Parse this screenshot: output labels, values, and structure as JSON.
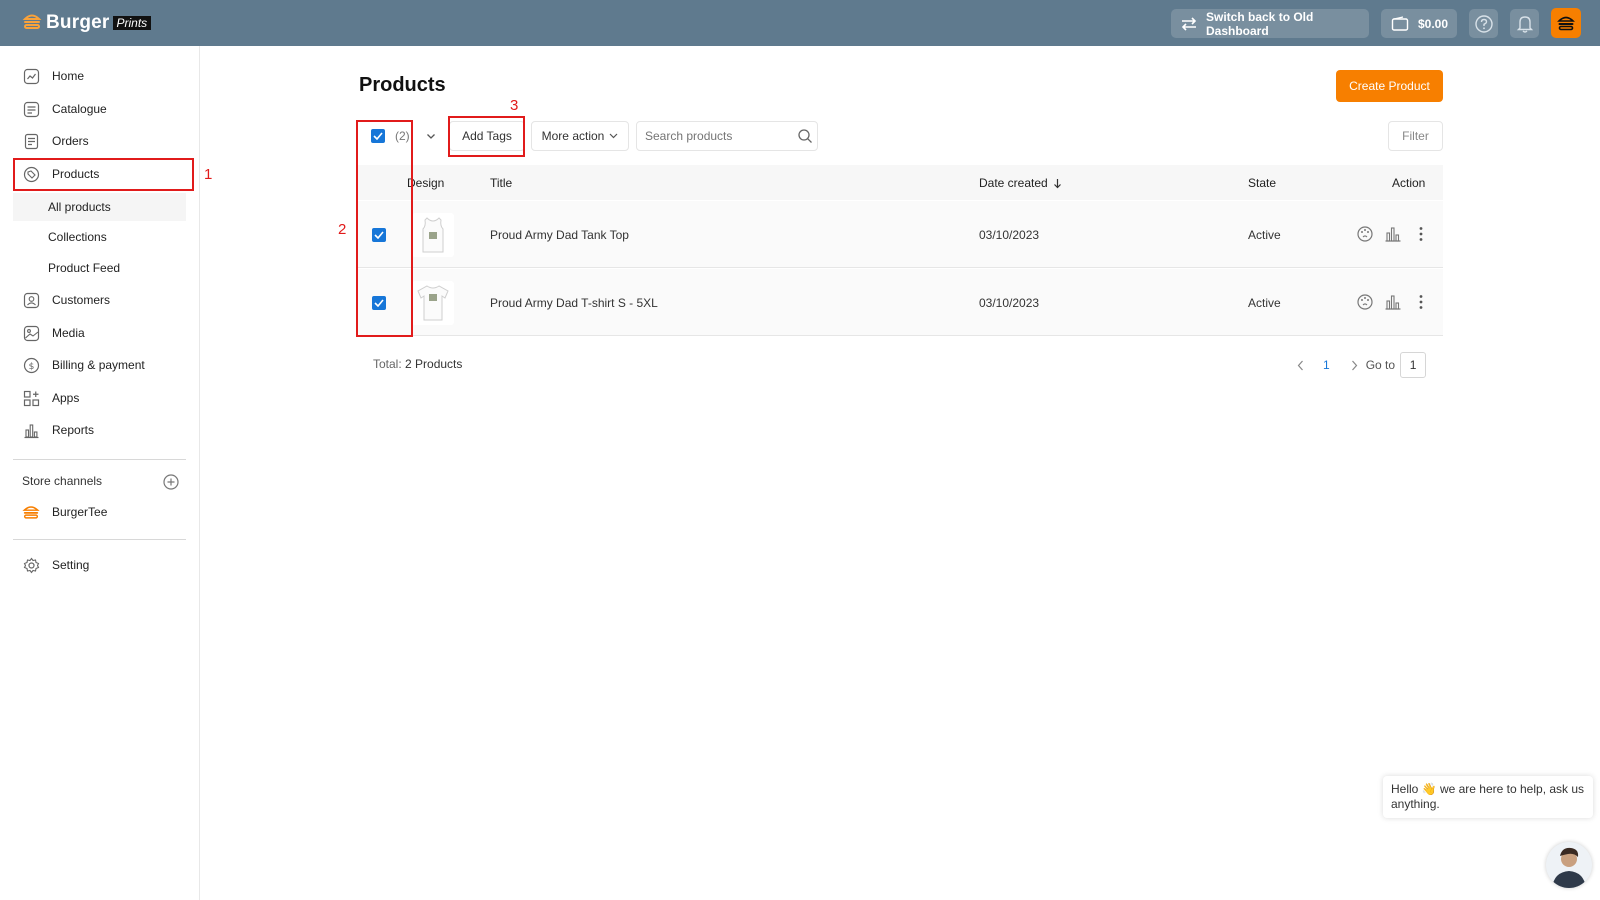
{
  "brand": {
    "name": "Burger",
    "sub": "Prints",
    "accent": "#f77f00",
    "topbar_color": "#5f7a8e"
  },
  "topbar": {
    "switch_label": "Switch back to Old Dashboard",
    "balance": "$0.00",
    "help_icon": "question-circle-icon",
    "bell_icon": "bell-icon"
  },
  "sidebar": {
    "items": [
      {
        "label": "Home",
        "icon": "home-chart-icon"
      },
      {
        "label": "Catalogue",
        "icon": "catalogue-icon"
      },
      {
        "label": "Orders",
        "icon": "orders-icon"
      },
      {
        "label": "Products",
        "icon": "tag-icon"
      },
      {
        "label": "Customers",
        "icon": "customers-icon"
      },
      {
        "label": "Media",
        "icon": "media-icon"
      },
      {
        "label": "Billing & payment",
        "icon": "dollar-icon"
      },
      {
        "label": "Apps",
        "icon": "apps-icon"
      },
      {
        "label": "Reports",
        "icon": "reports-icon"
      }
    ],
    "sub_items": [
      {
        "label": "All products"
      },
      {
        "label": "Collections"
      },
      {
        "label": "Product Feed"
      }
    ],
    "store_channels_label": "Store channels",
    "channel": {
      "label": "BurgerTee"
    },
    "setting_label": "Setting"
  },
  "annotations": {
    "one": "1",
    "two": "2",
    "three": "3"
  },
  "main": {
    "title": "Products",
    "create_button": "Create Product",
    "selected_count": "(2)",
    "add_tags": "Add Tags",
    "more_action": "More action",
    "search_placeholder": "Search products",
    "filter": "Filter",
    "columns": {
      "design": "Design",
      "title": "Title",
      "date_created": "Date created",
      "state": "State",
      "action": "Action"
    },
    "rows": [
      {
        "title": "Proud Army Dad Tank Top",
        "date": "03/10/2023",
        "state": "Active"
      },
      {
        "title": "Proud Army Dad T-shirt S - 5XL",
        "date": "03/10/2023",
        "state": "Active"
      }
    ],
    "total_label": "Total:",
    "total_value": "2 Products",
    "pagination": {
      "current_page": "1",
      "goto_label": "Go to",
      "goto_value": "1"
    }
  },
  "chat": {
    "message": "Hello 👋 we are here to help, ask us anything."
  }
}
